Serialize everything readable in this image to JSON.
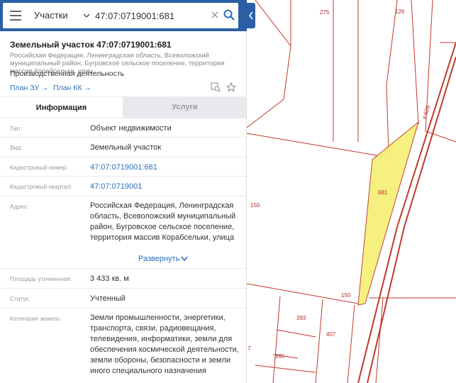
{
  "search": {
    "type_label": "Участки",
    "query": "47:07:0719001:681"
  },
  "parcel": {
    "title": "Земельный участок 47:07:0719001:681",
    "address_short": "Российская Федерация, Ленинградская область, Всеволожский муниципальный район, Бугровское сельское поселение, территория массив Корабсельки, улиц...",
    "use": "Производственная деятельность",
    "plan_zu": "План ЗУ →",
    "plan_kk": "План КК →"
  },
  "tabs": [
    {
      "label": "Информация",
      "active": true
    },
    {
      "label": "Услуги",
      "active": false
    }
  ],
  "details": {
    "type": {
      "label": "Тип:",
      "value": "Объект недвижимости"
    },
    "kind": {
      "label": "Вид:",
      "value": "Земельный участок"
    },
    "cad_number": {
      "label": "Кадастровый номер:",
      "value": "47:07:0719001:681"
    },
    "cad_quarter": {
      "label": "Кадастровый квартал:",
      "value": "47:07:0719001"
    },
    "address": {
      "label": "Адрес:",
      "value": "Российская Федерация, Ленинградская область, Всеволожский муниципальный район, Бугровское сельское поселение, территория массив Корабсельки, улица",
      "expand": "Развернуть"
    },
    "area": {
      "label": "Площадь уточненная:",
      "value": "3 433 кв. м"
    },
    "status": {
      "label": "Статус:",
      "value": "Учтенный"
    },
    "category": {
      "label": "Категория земель:",
      "value": "Земли промышленности, энергетики, транспорта, связи, радиовещания, телевидения, информатики, земли для обеспечения космической деятельности, земли обороны, безопасности и земли иного специального назначения"
    }
  },
  "map_labels": {
    "p275": "275",
    "p126": "126",
    "p681": "681",
    "p150a": "150",
    "p150b": "150",
    "p393": "393",
    "p407": "407",
    "p395": "395",
    "p7": "7",
    "road": "к-626"
  },
  "colors": {
    "header": "#2a5fa6",
    "link": "#2a6ebb",
    "parcel_fill": "#f5f07a",
    "boundary": "#c0392b"
  }
}
